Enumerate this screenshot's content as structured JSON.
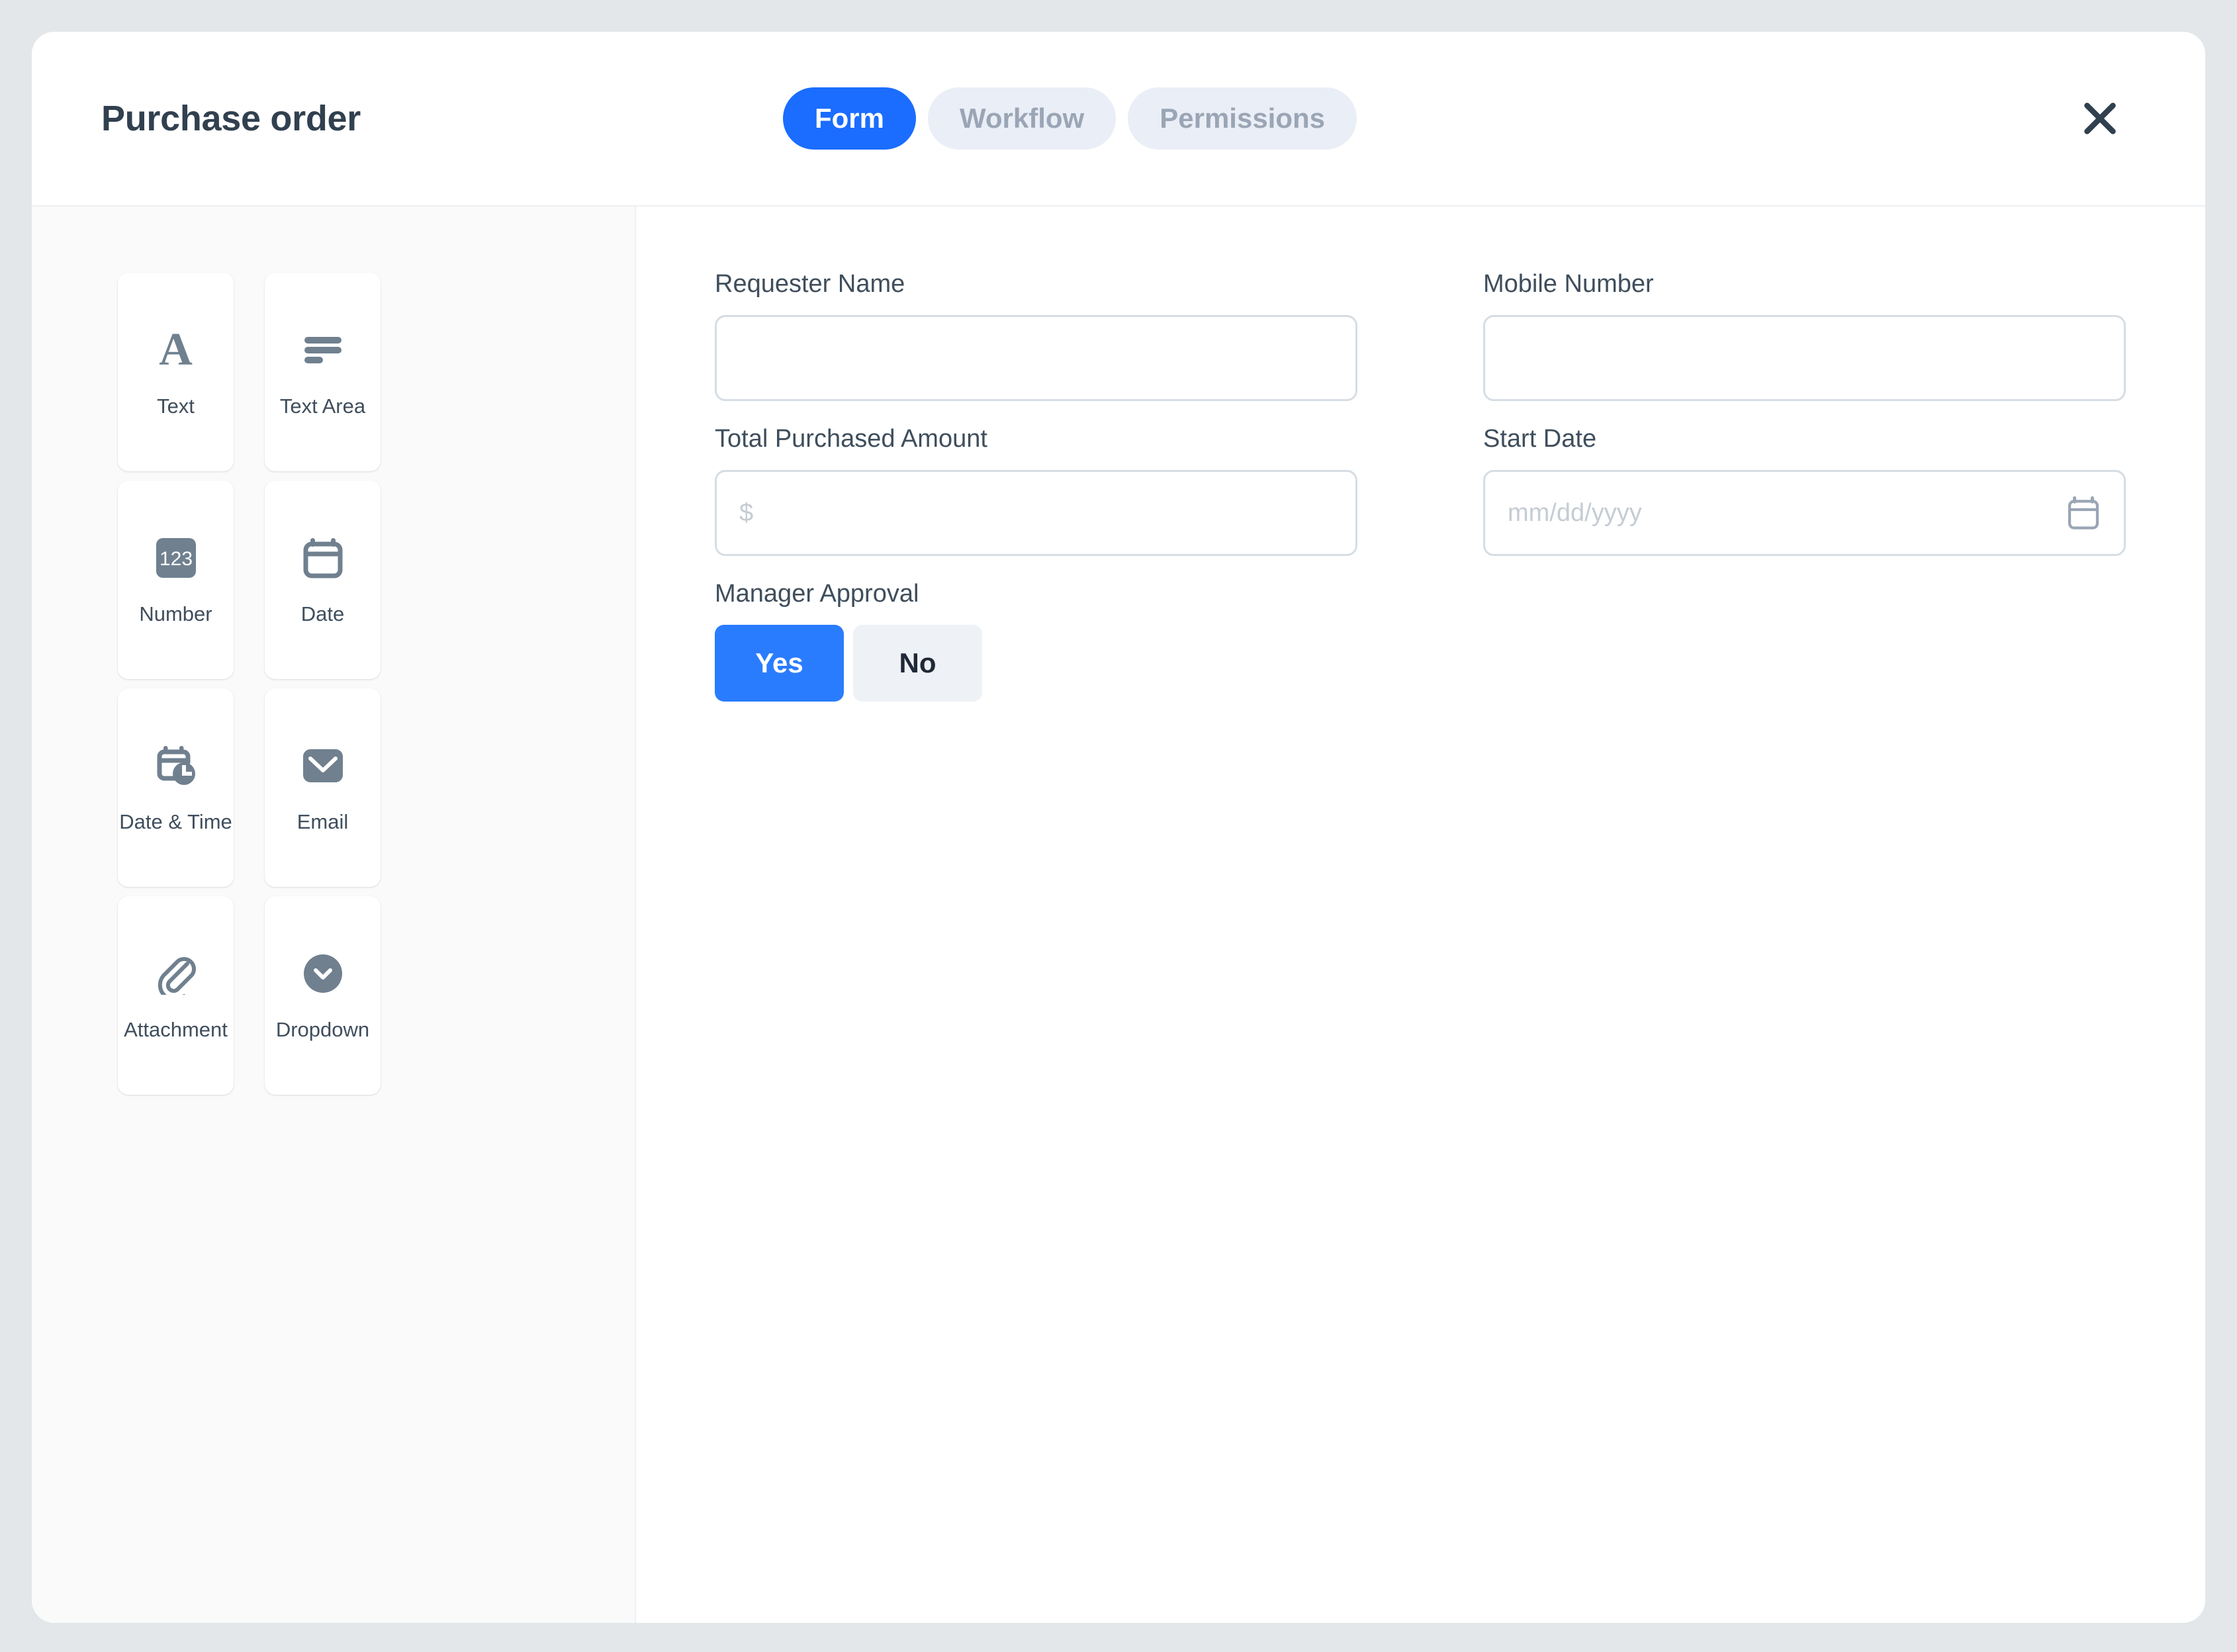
{
  "header": {
    "title": "Purchase order",
    "tabs": [
      {
        "label": "Form",
        "active": true
      },
      {
        "label": "Workflow",
        "active": false
      },
      {
        "label": "Permissions",
        "active": false
      }
    ],
    "close_icon": "close-icon"
  },
  "palette": {
    "items": [
      {
        "label": "Text",
        "icon": "letter-a-icon"
      },
      {
        "label": "Text Area",
        "icon": "text-lines-icon"
      },
      {
        "label": "Number",
        "icon": "number-123-icon",
        "badge": "123"
      },
      {
        "label": "Date",
        "icon": "calendar-icon"
      },
      {
        "label": "Date & Time",
        "icon": "calendar-clock-icon"
      },
      {
        "label": "Email",
        "icon": "envelope-icon"
      },
      {
        "label": "Attachment",
        "icon": "paperclip-icon"
      },
      {
        "label": "Dropdown",
        "icon": "chevron-down-circle-icon"
      }
    ]
  },
  "form": {
    "fields": [
      {
        "label": "Requester Name",
        "value": "",
        "placeholder": "",
        "type": "text"
      },
      {
        "label": "Mobile Number",
        "value": "",
        "placeholder": "",
        "type": "text"
      },
      {
        "label": "Total Purchased Amount",
        "value": "",
        "placeholder": "$",
        "type": "text"
      },
      {
        "label": "Start Date",
        "value": "",
        "placeholder": "mm/dd/yyyy",
        "type": "date"
      }
    ],
    "approval": {
      "label": "Manager Approval",
      "options": [
        {
          "label": "Yes",
          "selected": true
        },
        {
          "label": "No",
          "selected": false
        }
      ]
    }
  },
  "colors": {
    "accent": "#1a6dff",
    "accent_selected": "#2a7cff",
    "tab_inactive_bg": "#eaeef6",
    "tab_inactive_text": "#9aa5b5",
    "icon_gray": "#70808f",
    "label_text": "#3f4e5c",
    "title_text": "#31404f",
    "input_border": "#d6dde3",
    "placeholder": "#c5ccd4",
    "sidebar_bg": "#fafafb",
    "page_bg": "#e3e7ea"
  }
}
